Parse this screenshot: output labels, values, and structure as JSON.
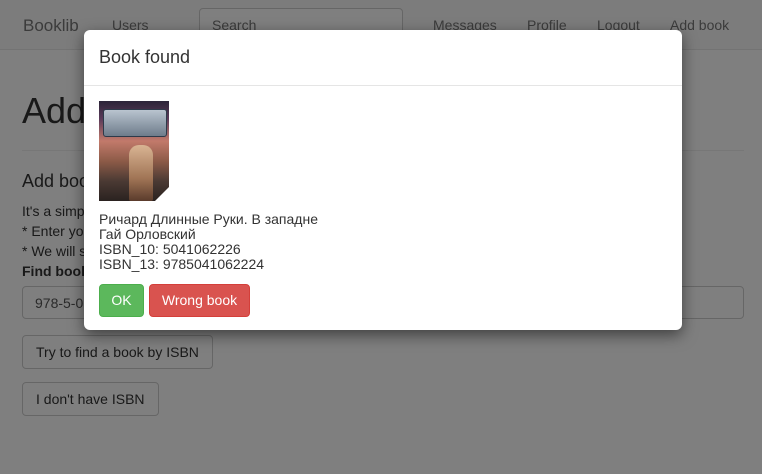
{
  "navbar": {
    "brand": "Booklib",
    "users": "Users",
    "search_placeholder": "Search",
    "messages": "Messages",
    "profile": "Profile",
    "logout": "Logout",
    "add_book": "Add book"
  },
  "page": {
    "title": "Add book",
    "section_title": "Add book by ISBN",
    "intro": "It's a simple way to add a book",
    "hint1": "* Enter your ISBN code",
    "hint2": "* We will search for the book",
    "find_label": "Find book by ISBN",
    "isbn_value": "978-5-0",
    "find_button": "Try to find a book by ISBN",
    "no_isbn_button": "I don't have ISBN"
  },
  "modal": {
    "title": "Book found",
    "book_title": "Ричард Длинные Руки. В западне",
    "author": "Гай Орловский",
    "isbn10": "ISBN_10: 5041062226",
    "isbn13": "ISBN_13: 9785041062224",
    "ok_label": "OK",
    "wrong_label": "Wrong book"
  },
  "colors": {
    "ok": "#5cb85c",
    "wrong": "#d9534f"
  }
}
